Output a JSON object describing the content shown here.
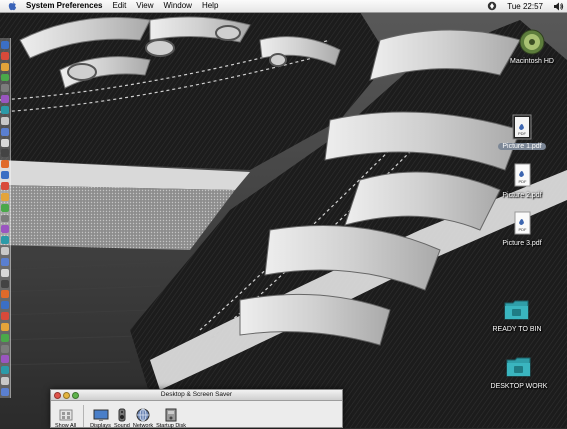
{
  "menubar": {
    "app_name": "System Preferences",
    "menus": [
      "Edit",
      "View",
      "Window",
      "Help"
    ],
    "clock": "Tue 22:57"
  },
  "desktop": {
    "icons": [
      {
        "label": "Macintosh HD",
        "icon": "hard-disk-icon",
        "selected": false
      },
      {
        "label": "Picture 1.pdf",
        "icon": "pdf-file-icon",
        "selected": true
      },
      {
        "label": "Picture 2.pdf",
        "icon": "pdf-file-icon",
        "selected": false
      },
      {
        "label": "Picture 3.pdf",
        "icon": "pdf-file-icon",
        "selected": false
      },
      {
        "label": "READY TO BIN",
        "icon": "folder-icon",
        "selected": false
      },
      {
        "label": "DESKTOP WORK",
        "icon": "folder-icon",
        "selected": false
      }
    ]
  },
  "window": {
    "title": "Desktop & Screen Saver",
    "toolbar": [
      {
        "label": "Show All",
        "icon": "show-all-icon"
      },
      {
        "label": "Displays",
        "icon": "displays-icon"
      },
      {
        "label": "Sound",
        "icon": "sound-icon"
      },
      {
        "label": "Network",
        "icon": "network-icon"
      },
      {
        "label": "Startup Disk",
        "icon": "startup-disk-icon"
      }
    ]
  },
  "colors": {
    "folder": "#2f9ea8",
    "selection": "#7c8796",
    "close": "#e0534a",
    "minimize": "#e4b43d",
    "zoom": "#5eb34a"
  }
}
